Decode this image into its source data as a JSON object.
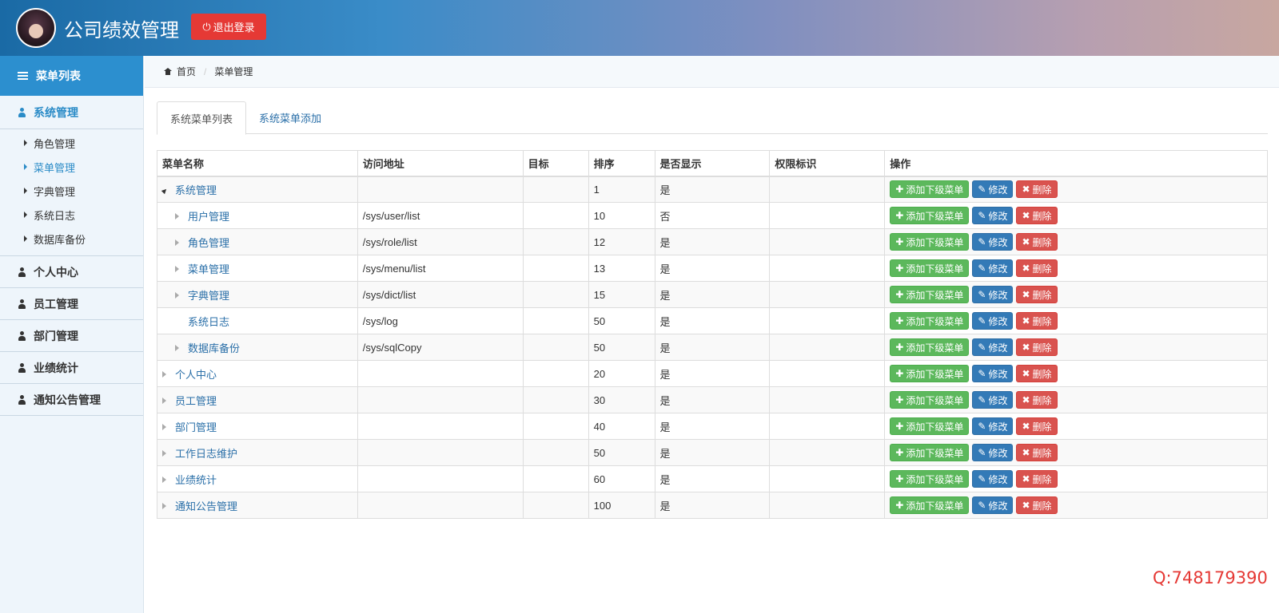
{
  "header": {
    "app_title": "公司绩效管理",
    "logout_label": "退出登录"
  },
  "sidebar": {
    "title": "菜单列表",
    "groups": [
      {
        "label": "系统管理",
        "active": true,
        "items": [
          {
            "label": "角色管理"
          },
          {
            "label": "菜单管理",
            "active": true
          },
          {
            "label": "字典管理"
          },
          {
            "label": "系统日志"
          },
          {
            "label": "数据库备份"
          }
        ]
      },
      {
        "label": "个人中心"
      },
      {
        "label": "员工管理"
      },
      {
        "label": "部门管理"
      },
      {
        "label": "业绩统计"
      },
      {
        "label": "通知公告管理"
      }
    ]
  },
  "breadcrumb": {
    "home": "首页",
    "current": "菜单管理"
  },
  "tabs": [
    {
      "label": "系统菜单列表",
      "active": true
    },
    {
      "label": "系统菜单添加"
    }
  ],
  "table": {
    "columns": [
      "菜单名称",
      "访问地址",
      "目标",
      "排序",
      "是否显示",
      "权限标识",
      "操作"
    ],
    "rows": [
      {
        "name": "系统管理",
        "url": "",
        "target": "",
        "order": "1",
        "show": "是",
        "perm": "",
        "level": 1,
        "expanded": true
      },
      {
        "name": "用户管理",
        "url": "/sys/user/list",
        "target": "",
        "order": "10",
        "show": "否",
        "perm": "",
        "level": 2
      },
      {
        "name": "角色管理",
        "url": "/sys/role/list",
        "target": "",
        "order": "12",
        "show": "是",
        "perm": "",
        "level": 2
      },
      {
        "name": "菜单管理",
        "url": "/sys/menu/list",
        "target": "",
        "order": "13",
        "show": "是",
        "perm": "",
        "level": 2
      },
      {
        "name": "字典管理",
        "url": "/sys/dict/list",
        "target": "",
        "order": "15",
        "show": "是",
        "perm": "",
        "level": 2
      },
      {
        "name": "系统日志",
        "url": "/sys/log",
        "target": "",
        "order": "50",
        "show": "是",
        "perm": "",
        "level": 2,
        "leaf": true
      },
      {
        "name": "数据库备份",
        "url": "/sys/sqlCopy",
        "target": "",
        "order": "50",
        "show": "是",
        "perm": "",
        "level": 2
      },
      {
        "name": "个人中心",
        "url": "",
        "target": "",
        "order": "20",
        "show": "是",
        "perm": "",
        "level": 1
      },
      {
        "name": "员工管理",
        "url": "",
        "target": "",
        "order": "30",
        "show": "是",
        "perm": "",
        "level": 1
      },
      {
        "name": "部门管理",
        "url": "",
        "target": "",
        "order": "40",
        "show": "是",
        "perm": "",
        "level": 1
      },
      {
        "name": "工作日志维护",
        "url": "",
        "target": "",
        "order": "50",
        "show": "是",
        "perm": "",
        "level": 1
      },
      {
        "name": "业绩统计",
        "url": "",
        "target": "",
        "order": "60",
        "show": "是",
        "perm": "",
        "level": 1
      },
      {
        "name": "通知公告管理",
        "url": "",
        "target": "",
        "order": "100",
        "show": "是",
        "perm": "",
        "level": 1
      }
    ],
    "actions": {
      "add_child": "添加下级菜单",
      "edit": "修改",
      "delete": "删除"
    }
  },
  "watermark": "Q:748179390",
  "colors": {
    "accent": "#2a8bc7",
    "danger": "#e53935",
    "green": "#5cb85c",
    "blue": "#337ab7",
    "red": "#d9534f"
  }
}
